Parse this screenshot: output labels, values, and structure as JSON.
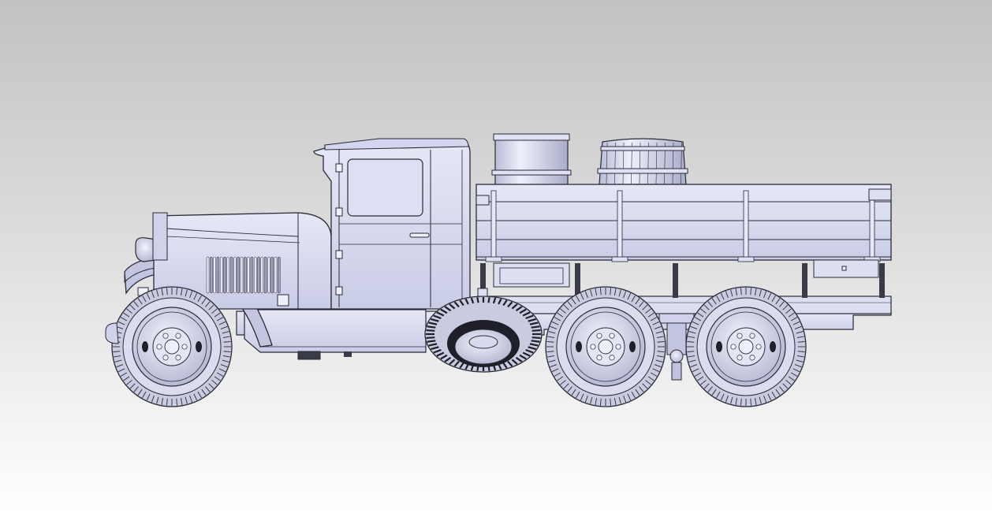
{
  "scene": {
    "colors": {
      "body": "#d7d9ee",
      "body_light": "#e4e6f6",
      "body_shadow": "#aeb1cc",
      "outline": "#2a2b36",
      "tire": "#c9cbe0",
      "tire_dark": "#1e1f28",
      "dark_part": "#3a3b48"
    },
    "parts": {
      "cab": "cab",
      "hood": "hood",
      "cargo_bed": "cargo-bed",
      "barrel": "barrel",
      "drum": "drum",
      "wheels": [
        "front-wheel",
        "middle-rear-wheel",
        "rear-wheel"
      ],
      "spare_wheel": "spare-wheel"
    }
  }
}
